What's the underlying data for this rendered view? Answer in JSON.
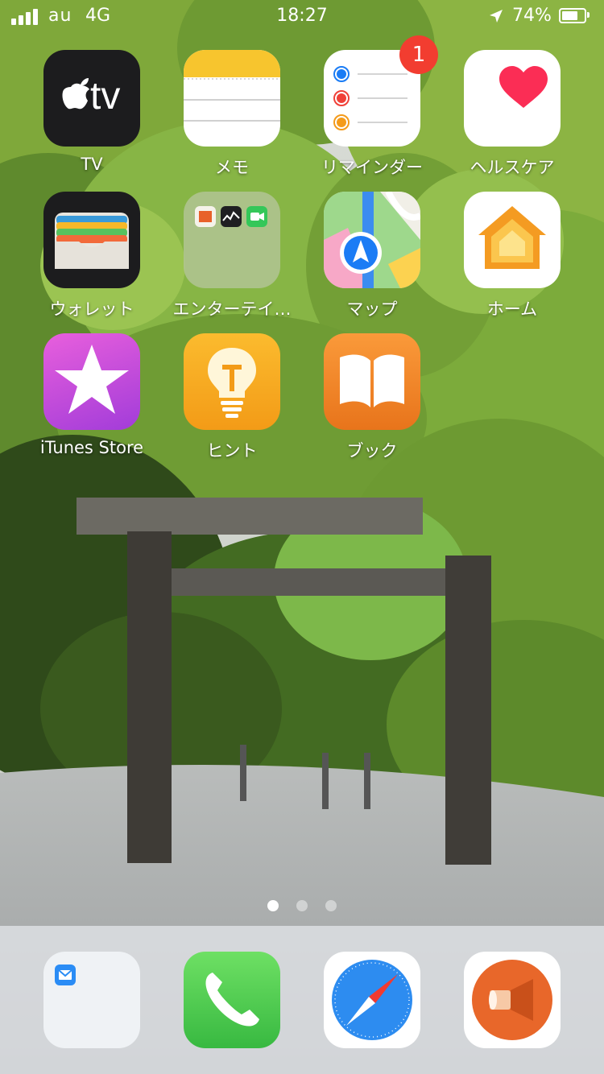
{
  "status_bar": {
    "carrier": "au",
    "network": "4G",
    "time": "18:27",
    "battery_percent": "74%",
    "battery_level": 0.74,
    "signal_bars": 4
  },
  "apps": [
    {
      "label": "TV",
      "icon": "apple-tv-icon"
    },
    {
      "label": "メモ",
      "icon": "notes-icon"
    },
    {
      "label": "リマインダー",
      "icon": "reminders-icon",
      "badge": "1"
    },
    {
      "label": "ヘルスケア",
      "icon": "health-icon"
    },
    {
      "label": "ウォレット",
      "icon": "wallet-icon"
    },
    {
      "label": "エンターテイ…",
      "icon": "folder-icon"
    },
    {
      "label": "マップ",
      "icon": "maps-icon"
    },
    {
      "label": "ホーム",
      "icon": "home-icon"
    },
    {
      "label": "iTunes Store",
      "icon": "itunes-store-icon"
    },
    {
      "label": "ヒント",
      "icon": "tips-icon"
    },
    {
      "label": "ブック",
      "icon": "books-icon"
    }
  ],
  "tv_icon_text": "tv",
  "page_indicator": {
    "count": 3,
    "active": 1
  },
  "dock": [
    {
      "icon": "mail-folder-icon"
    },
    {
      "icon": "phone-icon"
    },
    {
      "icon": "safari-icon"
    },
    {
      "icon": "megaphone-icon"
    }
  ],
  "colors": {
    "badge": "#f23d30",
    "dock_bg": "#e1e4e8"
  }
}
